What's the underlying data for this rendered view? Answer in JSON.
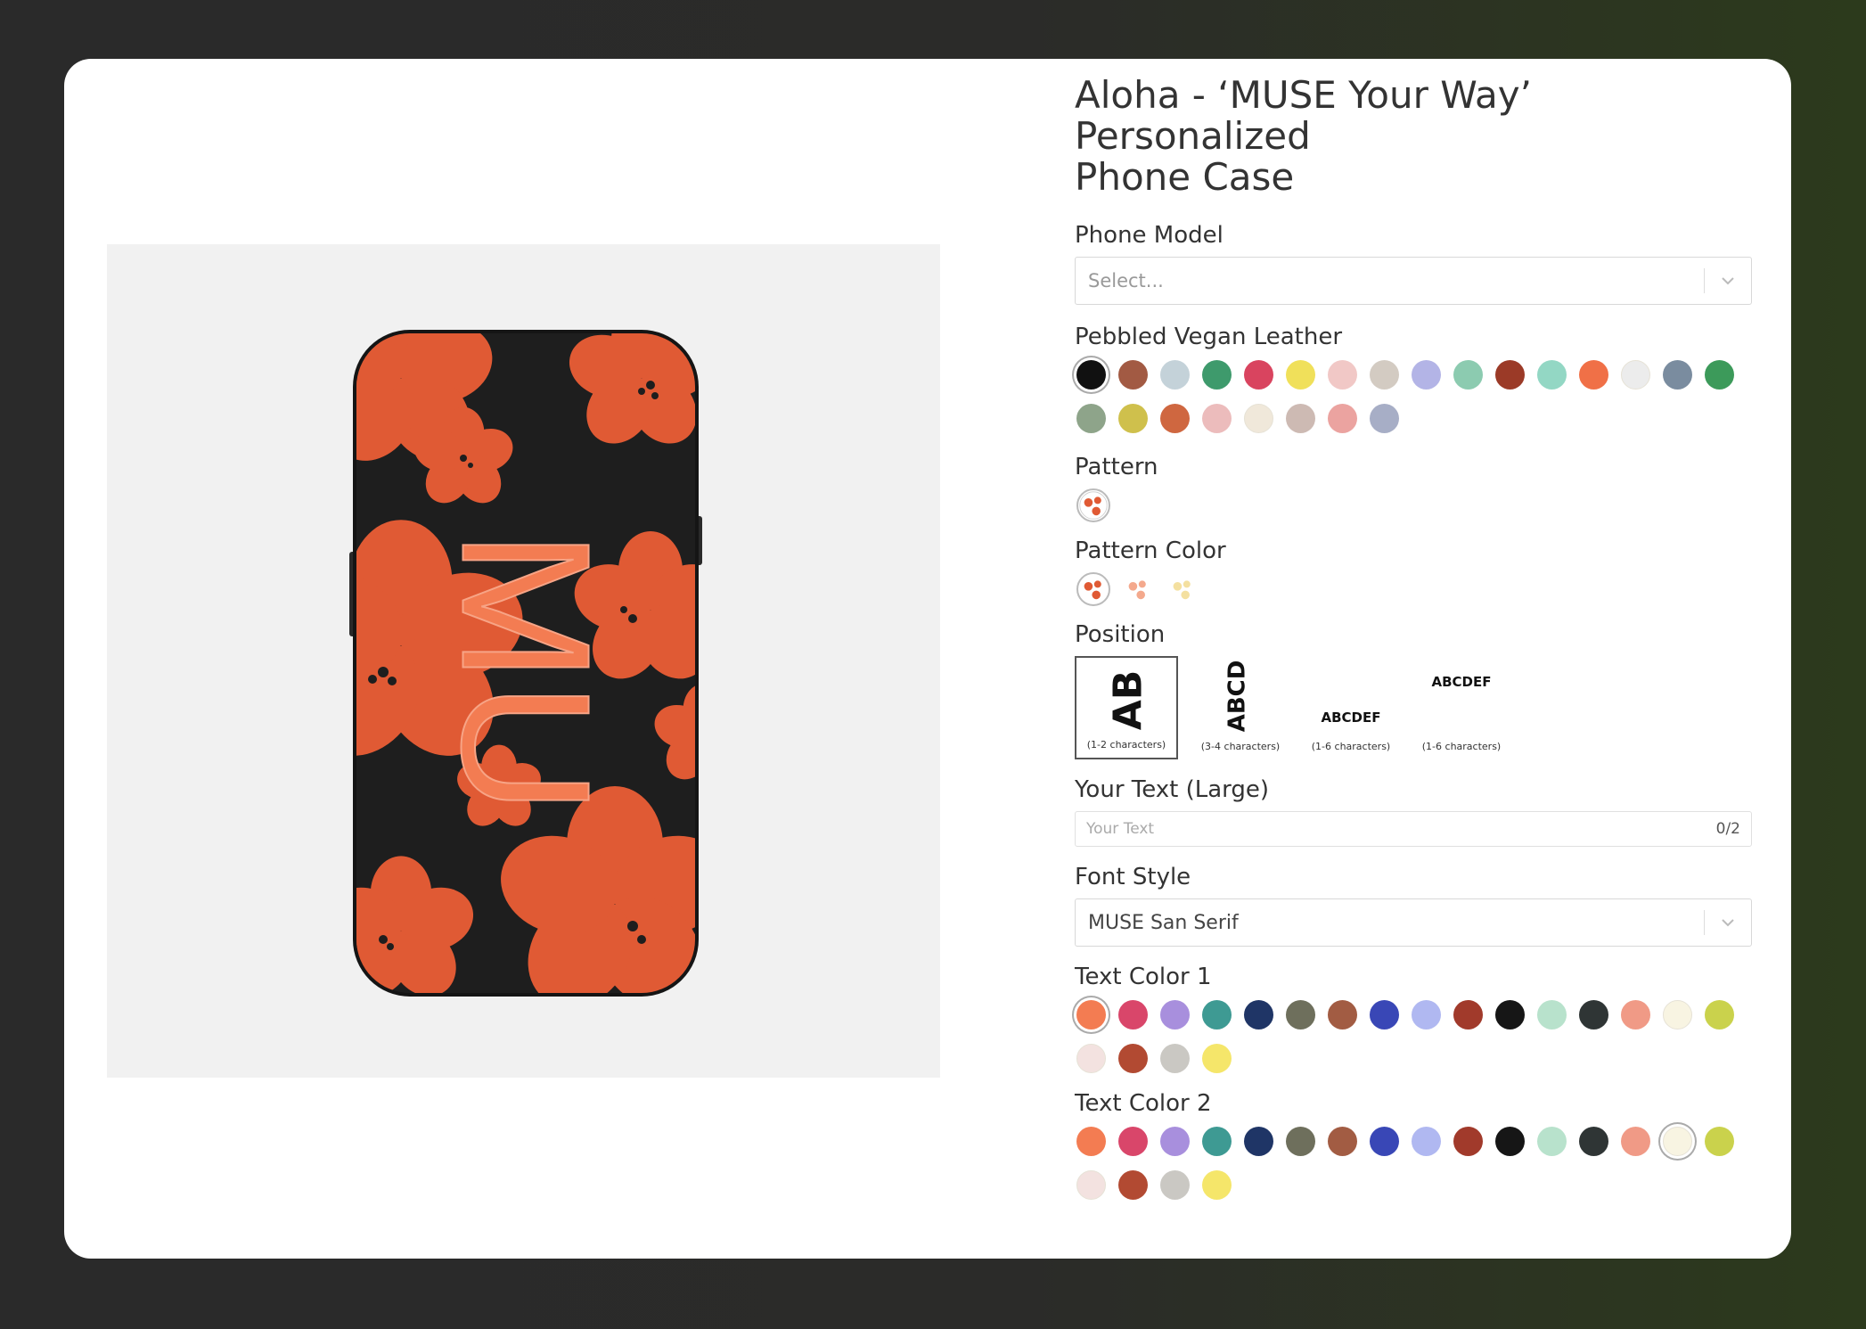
{
  "product": {
    "title_line1": "Aloha - ‘MUSE Your Way’ Personalized",
    "title_line2": "Phone Case"
  },
  "preview": {
    "monogram": "MU",
    "case_color": "#1e1e1e",
    "pattern_color": "#e05a34",
    "text_color_1": "#f37c52",
    "text_color_2": "#f37c52"
  },
  "phone_model": {
    "label": "Phone Model",
    "placeholder": "Select..."
  },
  "leather": {
    "label": "Pebbled Vegan Leather",
    "swatches": [
      "#111111",
      "#a25a43",
      "#c4d2d9",
      "#3e9a6c",
      "#d9445f",
      "#f0e05a",
      "#f1c8c6",
      "#d3cbc2",
      "#b3b4e6",
      "#8ccbb0",
      "#9b3a27",
      "#93d7c4",
      "#f07047",
      "#ececec",
      "#7a8c9f",
      "#3c9a5a",
      "#8ea48a",
      "#cfc04c",
      "#cf6740",
      "#ecbcbc",
      "#f0e8da",
      "#cdbab3",
      "#eba3a0",
      "#a7aec6"
    ],
    "selected_index": 0
  },
  "pattern": {
    "label": "Pattern",
    "icon": "flower-pattern-icon"
  },
  "pattern_color": {
    "label": "Pattern Color",
    "options": [
      "#e05a34",
      "#f4a98d",
      "#f4e0a0"
    ]
  },
  "position": {
    "label": "Position",
    "options": [
      {
        "sample": "AB",
        "caption": "(1-2 characters)"
      },
      {
        "sample": "ABCD",
        "caption": "(3-4 characters)"
      },
      {
        "sample": "ABCDEF",
        "caption": "(1-6 characters)"
      },
      {
        "sample": "ABCDEF",
        "caption": "(1-6 characters)"
      }
    ]
  },
  "your_text": {
    "label": "Your Text (Large)",
    "placeholder": "Your Text",
    "count": "0/2"
  },
  "font_style": {
    "label": "Font Style",
    "value": "MUSE San Serif"
  },
  "text_color_1": {
    "label": "Text Color 1",
    "swatches": [
      "#f37c52",
      "#d9466a",
      "#a88fdd",
      "#3e9a93",
      "#1f3566",
      "#6e6f5c",
      "#a25c43",
      "#3947b6",
      "#b0b8f1",
      "#a13a2b",
      "#161616",
      "#b8e2cc",
      "#2f3535",
      "#f09a86",
      "#f8f4e2",
      "#cad24c",
      "#f3e2e0",
      "#b24a32",
      "#cac8c3",
      "#f5e66a"
    ],
    "selected_index": 0
  },
  "text_color_2": {
    "label": "Text Color 2",
    "swatches": [
      "#f37c52",
      "#d9466a",
      "#a88fdd",
      "#3e9a93",
      "#1f3566",
      "#6e6f5c",
      "#a25c43",
      "#3947b6",
      "#b0b8f1",
      "#a13a2b",
      "#161616",
      "#b8e2cc",
      "#2f3535",
      "#f09a86",
      "#f8f4e2",
      "#cad24c",
      "#f3e2e0",
      "#b24a32",
      "#cac8c3",
      "#f5e66a"
    ],
    "selected_index": 14
  }
}
